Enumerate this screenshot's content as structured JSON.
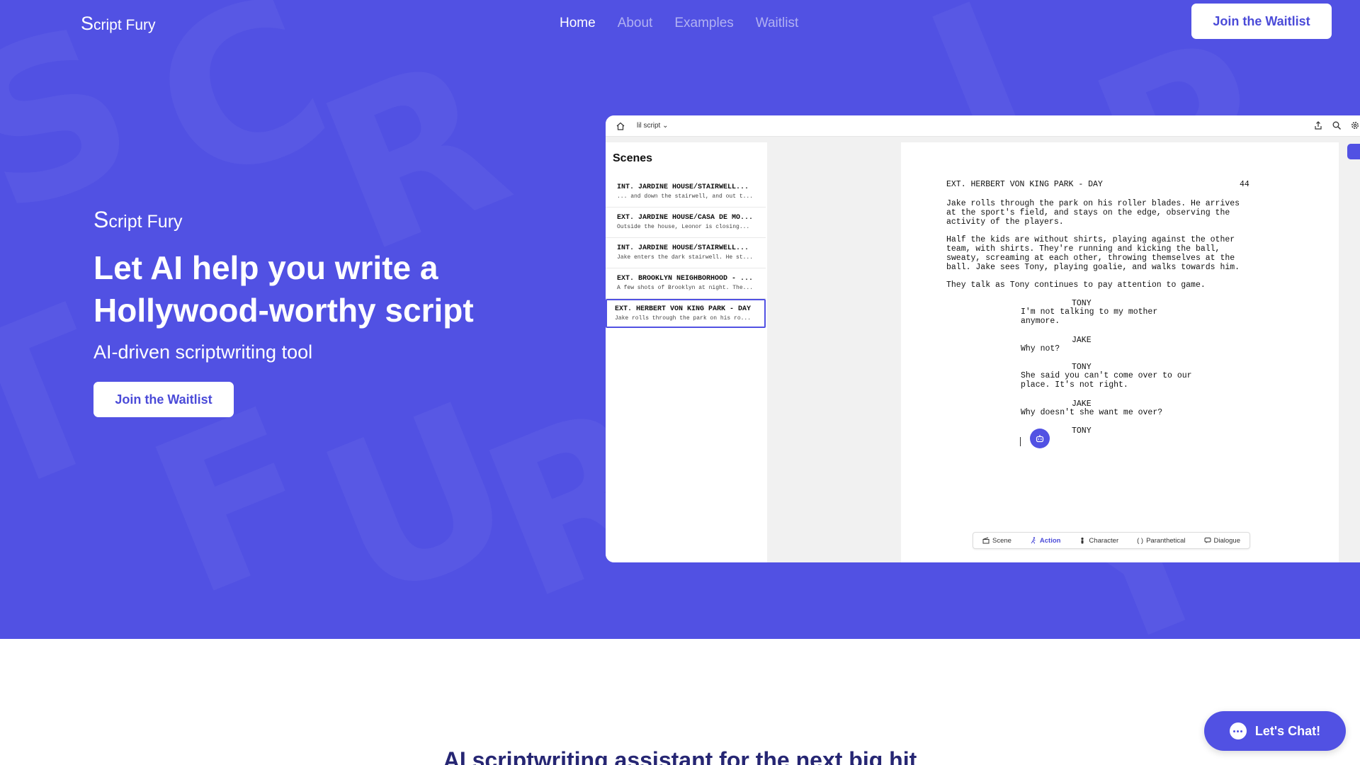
{
  "brand": {
    "name": "Script Fury",
    "initial": "S",
    "rest": "cript Fury"
  },
  "nav": {
    "links": [
      "Home",
      "About",
      "Examples",
      "Waitlist"
    ],
    "active": "Home",
    "cta_label": "Join the Waitlist"
  },
  "hero": {
    "title": "Let AI help you write a Hollywood-worthy script",
    "subtitle": "AI-driven scriptwriting tool",
    "cta_label": "Join the Waitlist",
    "background_color": "#5151e3",
    "background_text": [
      "S",
      "C",
      "R",
      "I",
      "P",
      "T",
      "F",
      "U",
      "R",
      "Y"
    ]
  },
  "app": {
    "document_name": "lil script",
    "scenes_title": "Scenes",
    "scenes": [
      {
        "heading": "INT. JARDINE HOUSE/STAIRWELL...",
        "preview": "... and down the stairwell, and out t..."
      },
      {
        "heading": "EXT. JARDINE HOUSE/CASA DE MO...",
        "preview": "Outside the house, Leonor is closing..."
      },
      {
        "heading": "INT. JARDINE HOUSE/STAIRWELL...",
        "preview": "Jake enters the dark stairwell. He st..."
      },
      {
        "heading": "EXT. BROOKLYN NEIGHBORHOOD - ...",
        "preview": "A few shots of Brooklyn at night. The..."
      },
      {
        "heading": "EXT. HERBERT VON KING PARK - DAY",
        "preview": "Jake rolls through the park on his ro...",
        "active": true
      }
    ],
    "script": {
      "scene_heading": "EXT. HERBERT VON KING PARK - DAY",
      "scene_number": "44",
      "action1": "Jake rolls through the park on his roller blades. He arrives\nat the sport's field, and stays on the edge, observing the\nactivity of the players.",
      "action2": "Half the kids are without shirts, playing against the other\nteam, with shirts. They're running and kicking the ball,\nsweaty, screaming at each other, throwing themselves at the\nball. Jake sees Tony, playing goalie, and walks towards him.",
      "action3": "They talk as Tony continues to pay attention to game.",
      "char1": "TONY",
      "dial1": "I'm not talking to my mother\nanymore.",
      "char2": "JAKE",
      "dial2": "Why not?",
      "char3": "TONY",
      "dial3": "She said you can't come over to our\nplace. It's not right.",
      "char4": "JAKE",
      "dial4": "Why doesn't she want me over?",
      "char5": "TONY"
    },
    "format_bar": {
      "items": [
        "Scene",
        "Action",
        "Character",
        "Paranthetical",
        "Dialogue"
      ],
      "active": "Action"
    }
  },
  "section": {
    "heading": "AI scriptwriting assistant for the next big hit"
  },
  "chat": {
    "label": "Let's Chat!"
  }
}
